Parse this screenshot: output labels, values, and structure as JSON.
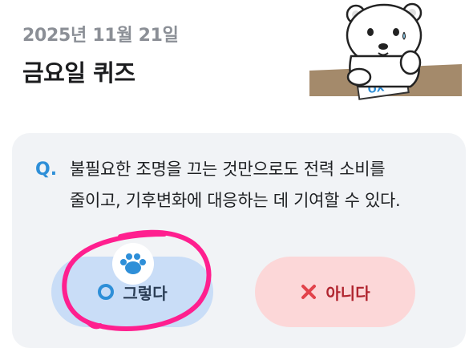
{
  "header": {
    "date": "2025년 11월 21일",
    "title": "금요일 퀴즈"
  },
  "mascot": {
    "icon": "polar-bear-mascot-icon",
    "paper_text": "OX"
  },
  "quiz": {
    "q_mark": "Q.",
    "question_lines": [
      "불필요한 조명을 끄는 것만으로도 전력 소비를",
      "줄이고, 기후변화에 대응하는 데 기여할 수 있다."
    ],
    "options": {
      "yes": {
        "label": "그렇다",
        "icon": "circle-o-icon",
        "color": "#2e8fd8"
      },
      "no": {
        "label": "아니다",
        "icon": "x-mark-icon",
        "color": "#e2434b"
      }
    },
    "selected_badge_icon": "paw-icon"
  },
  "colors": {
    "accent": "#2e8fd8",
    "annotation_scribble": "#ff1f8f"
  }
}
